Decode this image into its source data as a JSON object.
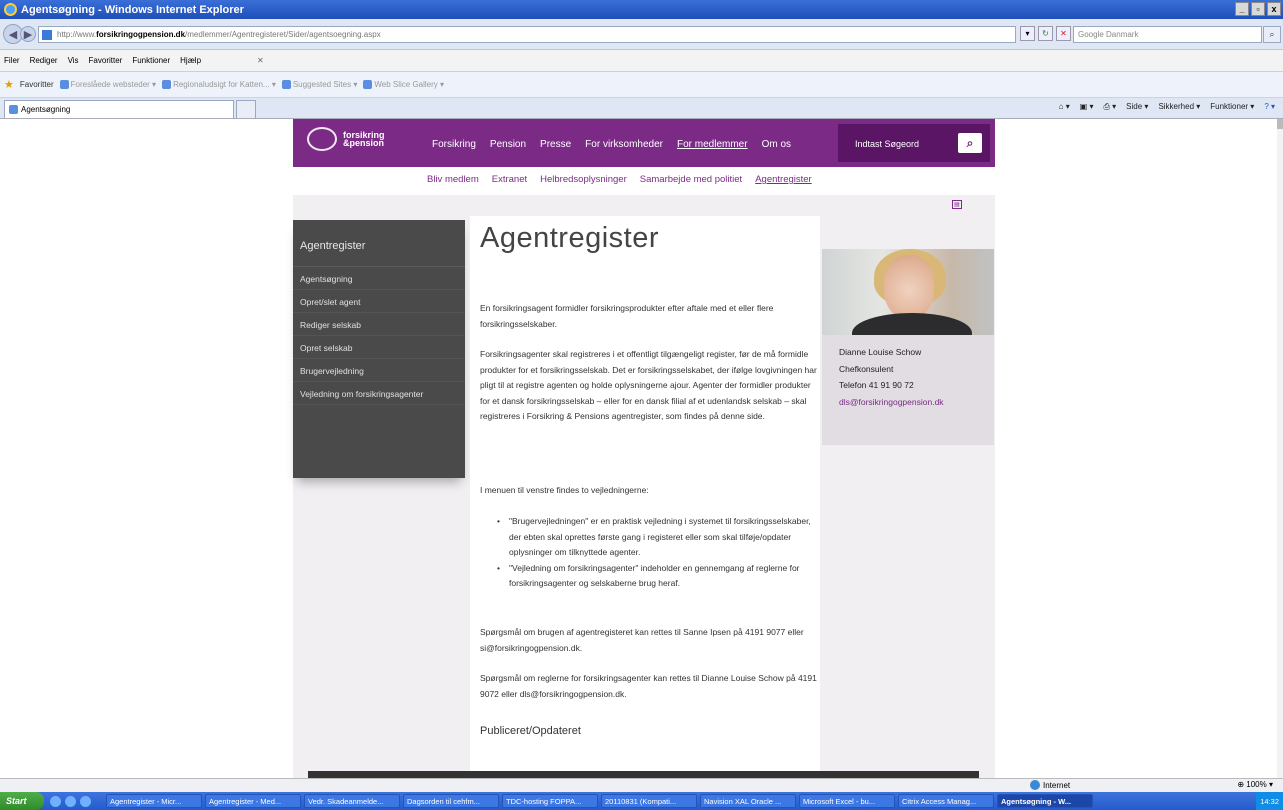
{
  "window": {
    "title": "Agentsøgning - Windows Internet Explorer",
    "controls": [
      "_",
      "▫",
      "x"
    ]
  },
  "address": {
    "url_prefix": "http://www.",
    "url_domain": "forsikringogpension.dk",
    "url_path": "/medlemmer/Agentregisteret/Sider/agentsoegning.aspx",
    "search_placeholder": "Google Danmark"
  },
  "menubar": [
    "Filer",
    "Rediger",
    "Vis",
    "Favoritter",
    "Funktioner",
    "Hjælp"
  ],
  "favorites": {
    "label": "Favoritter",
    "items": [
      "Foreslåede websteder",
      "Regionaludsigt for Katten...",
      "Suggested Sites",
      "Web Slice Gallery"
    ]
  },
  "tab": {
    "title": "Agentsøgning"
  },
  "commandbar": [
    "Side",
    "Sikkerhed",
    "Funktioner"
  ],
  "site": {
    "logo_line1": "forsikring",
    "logo_line2": "&pension",
    "nav": [
      "Forsikring",
      "Pension",
      "Presse",
      "For virksomheder",
      "For medlemmer",
      "Om os"
    ],
    "search_placeholder": "Indtast Søgeord",
    "subnav": [
      "Bliv medlem",
      "Extranet",
      "Helbredsoplysninger",
      "Samarbejde med politiet",
      "Agentregister"
    ]
  },
  "leftnav": {
    "title": "Agentregister",
    "items": [
      "Agentsøgning",
      "Opret/slet agent",
      "Rediger selskab",
      "Opret selskab",
      "Brugervejledning",
      "Vejledning om forsikringsagenter"
    ]
  },
  "main": {
    "title": "Agentregister",
    "p1": "En forsikringsagent formidler forsikringsprodukter efter aftale med et eller flere forsikringsselskaber.",
    "p2": "Forsikringsagenter skal registreres i et offentligt tilgængeligt register, før de må formidle produkter for et forsikringsselskab. Det er forsikringsselskabet, der ifølge lovgivningen har pligt til at registre agenten og holde oplysningerne ajour. Agenter der formidler produkter for et dansk forsikringsselskab – eller for en dansk filial af et udenlandsk selskab – skal registreres i Forsikring & Pensions agentregister, som findes på denne side.",
    "p3": "I menuen til venstre findes to vejledningerne:",
    "bullet1": "\"Brugervejledningen\" er en praktisk vejledning i systemet til forsikringsselskaber, der ebten skal oprettes første gang i registeret eller som skal tilføje/opdater oplysninger om tilknyttede agenter.",
    "bullet2": "\"Vejledning om forsikringsagenter\" indeholder en gennemgang af reglerne for forsikringsagenter og selskaberne brug heraf.",
    "p4": "Spørgsmål om brugen af agentregisteret kan rettes til Sanne Ipsen på 4191 9077 eller si@forsikringogpension.dk.",
    "p5": "Spørgsmål om reglerne for forsikringsagenter kan rettes til Dianne Louise Schow på 4191 9072 eller dls@forsikringogpension.dk.",
    "published": "Publiceret/Opdateret"
  },
  "contact": {
    "name": "Dianne Louise Schow",
    "role": "Chefkonsulent",
    "phone": "Telefon 41 91 90 72",
    "email": "dls@forsikringogpension.dk"
  },
  "statusbar": {
    "zone": "Internet",
    "zoom": "100%"
  },
  "taskbar": {
    "start": "Start",
    "tasks": [
      "Agentregister - Micr...",
      "Agentregister - Med...",
      "Vedr. Skadeanmelde...",
      "Dagsorden til cehfm...",
      "TDC-hosting FOPPA...",
      "20110831 (Kompati...",
      "Navision XAL Oracle ...",
      "Microsoft Excel - bu...",
      "Citrix Access Manag...",
      "Agentsøgning - W..."
    ],
    "clock": "14:32"
  }
}
